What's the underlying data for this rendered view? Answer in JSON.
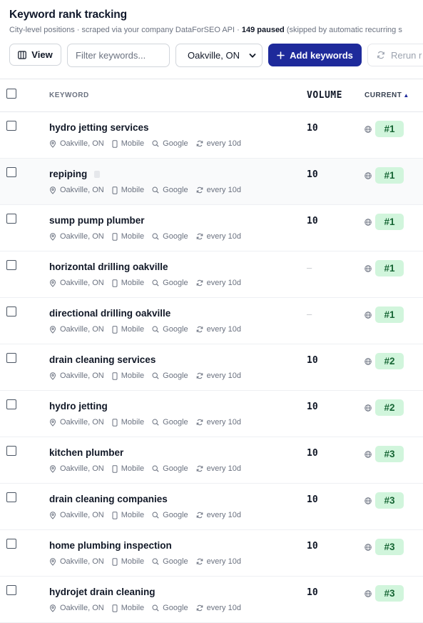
{
  "header": {
    "title": "Keyword rank tracking",
    "subtitle_prefix": "City-level positions · scraped via your company DataForSEO API · ",
    "paused_count": "149 paused",
    "subtitle_suffix": " (skipped by automatic recurring s"
  },
  "toolbar": {
    "view_label": "View",
    "filter_placeholder": "Filter keywords...",
    "location_value": "Oakville, ON",
    "add_label": "Add keywords",
    "rerun_label": "Rerun r"
  },
  "table": {
    "columns": {
      "keyword": "KEYWORD",
      "volume": "VOLUME",
      "current": "CURRENT"
    },
    "sort_indicator": "▲",
    "rows": [
      {
        "keyword": "hydro jetting services",
        "location": "Oakville, ON",
        "device": "Mobile",
        "engine": "Google",
        "frequency": "every 10d",
        "volume": "10",
        "rank": "#1",
        "tagged": false
      },
      {
        "keyword": "repiping",
        "location": "Oakville, ON",
        "device": "Mobile",
        "engine": "Google",
        "frequency": "every 10d",
        "volume": "10",
        "rank": "#1",
        "tagged": true
      },
      {
        "keyword": "sump pump plumber",
        "location": "Oakville, ON",
        "device": "Mobile",
        "engine": "Google",
        "frequency": "every 10d",
        "volume": "10",
        "rank": "#1",
        "tagged": false
      },
      {
        "keyword": "horizontal drilling oakville",
        "location": "Oakville, ON",
        "device": "Mobile",
        "engine": "Google",
        "frequency": "every 10d",
        "volume": "–",
        "rank": "#1",
        "tagged": false
      },
      {
        "keyword": "directional drilling oakville",
        "location": "Oakville, ON",
        "device": "Mobile",
        "engine": "Google",
        "frequency": "every 10d",
        "volume": "–",
        "rank": "#1",
        "tagged": false
      },
      {
        "keyword": "drain cleaning services",
        "location": "Oakville, ON",
        "device": "Mobile",
        "engine": "Google",
        "frequency": "every 10d",
        "volume": "10",
        "rank": "#2",
        "tagged": false
      },
      {
        "keyword": "hydro jetting",
        "location": "Oakville, ON",
        "device": "Mobile",
        "engine": "Google",
        "frequency": "every 10d",
        "volume": "10",
        "rank": "#2",
        "tagged": false
      },
      {
        "keyword": "kitchen plumber",
        "location": "Oakville, ON",
        "device": "Mobile",
        "engine": "Google",
        "frequency": "every 10d",
        "volume": "10",
        "rank": "#3",
        "tagged": false
      },
      {
        "keyword": "drain cleaning companies",
        "location": "Oakville, ON",
        "device": "Mobile",
        "engine": "Google",
        "frequency": "every 10d",
        "volume": "10",
        "rank": "#3",
        "tagged": false
      },
      {
        "keyword": "home plumbing inspection",
        "location": "Oakville, ON",
        "device": "Mobile",
        "engine": "Google",
        "frequency": "every 10d",
        "volume": "10",
        "rank": "#3",
        "tagged": false
      },
      {
        "keyword": "hydrojet drain cleaning",
        "location": "Oakville, ON",
        "device": "Mobile",
        "engine": "Google",
        "frequency": "every 10d",
        "volume": "10",
        "rank": "#3",
        "tagged": false
      }
    ]
  },
  "colors": {
    "primary": "#1e2a9b",
    "rank_bg": "#d1f5dc",
    "rank_text": "#166534"
  },
  "icons": {
    "view": "columns-icon",
    "add": "plus-icon",
    "rerun": "refresh-icon",
    "location": "pin-icon",
    "device": "phone-icon",
    "engine": "search-icon",
    "frequency": "repeat-icon",
    "rank_scope": "globe-icon"
  }
}
